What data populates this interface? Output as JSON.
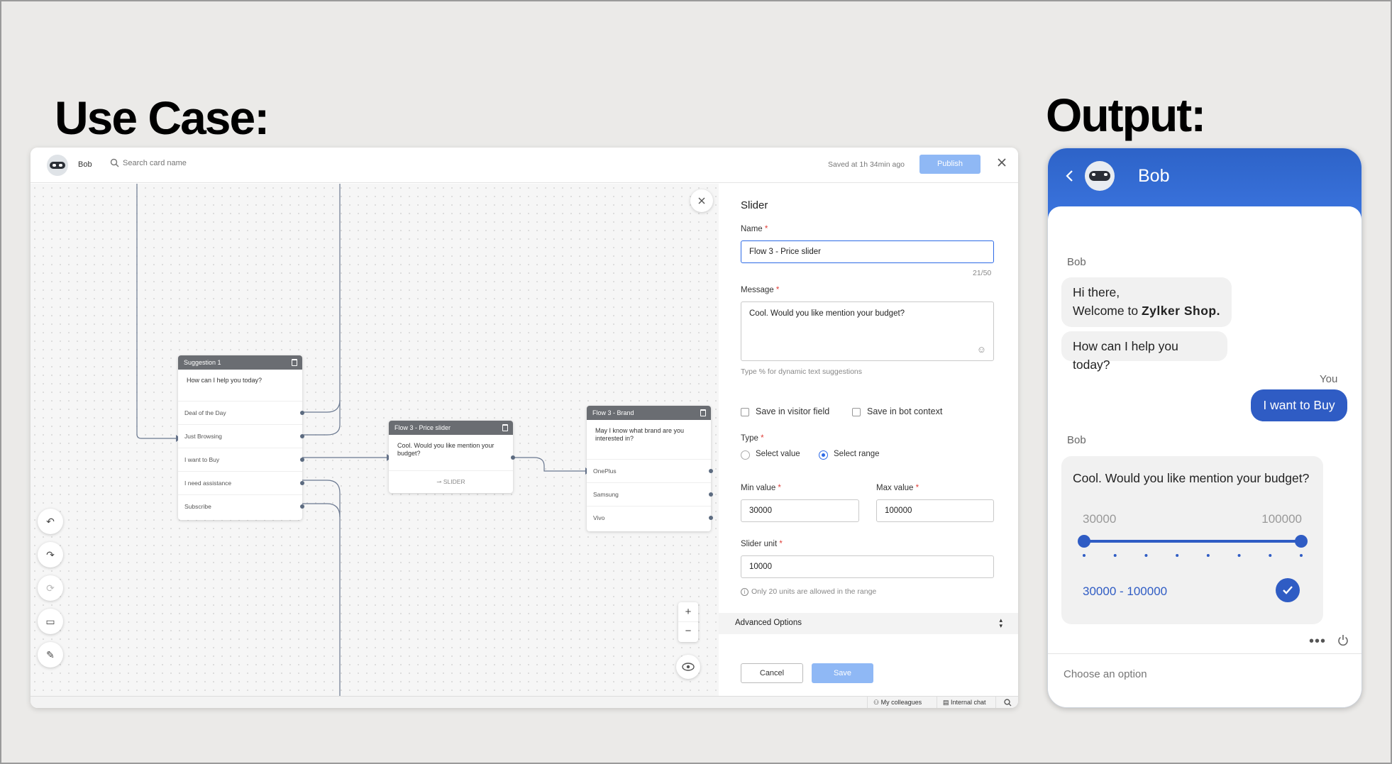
{
  "headings": {
    "use_case": "Use Case:",
    "output": "Output:"
  },
  "builder": {
    "bot_name": "Bob",
    "search_placeholder": "Search card name",
    "saved_status": "Saved at 1h 34min ago",
    "publish_label": "Publish",
    "cards": {
      "suggestion": {
        "title": "Suggestion 1",
        "message": "How can I help you today?",
        "options": [
          "Deal of the Day",
          "Just Browsing",
          "I want to Buy",
          "I need assistance",
          "Subscribe"
        ]
      },
      "price_slider": {
        "title": "Flow 3 - Price slider",
        "message": "Cool. Would you like mention your budget?",
        "footer": "SLIDER"
      },
      "brand": {
        "title": "Flow 3 - Brand",
        "message": "May I know what brand are you interested in?",
        "options": [
          "OnePlus",
          "Samsung",
          "Vivo"
        ]
      }
    },
    "form": {
      "title": "Slider",
      "name_label": "Name",
      "name_value": "Flow 3 - Price slider",
      "name_counter": "21/50",
      "message_label": "Message",
      "message_value": "Cool. Would you like mention your budget?",
      "message_hint": "Type % for dynamic text suggestions",
      "save_visitor_label": "Save in visitor field",
      "save_bot_label": "Save in bot context",
      "type_label": "Type",
      "type_options": [
        "Select value",
        "Select range"
      ],
      "type_selected": "Select range",
      "min_label": "Min value",
      "min_value": "30000",
      "max_label": "Max value",
      "max_value": "100000",
      "unit_label": "Slider unit",
      "unit_value": "10000",
      "unit_hint": "Only 20 units are allowed in the range",
      "advanced_label": "Advanced Options",
      "cancel_label": "Cancel",
      "save_label": "Save"
    },
    "statusbar": {
      "colleagues": "My colleagues",
      "internal_chat": "Internal chat"
    }
  },
  "chat": {
    "bot_name": "Bob",
    "messages": [
      {
        "sender": "Bob",
        "line1": "Hi there,",
        "line2_prefix": "Welcome to ",
        "line2_bold": "Zylker Shop."
      },
      {
        "text": "How can I help you today?"
      },
      {
        "sender": "You",
        "text": "I want to Buy"
      },
      {
        "sender": "Bob",
        "text": "Cool. Would you like mention your budget?"
      }
    ],
    "slider": {
      "min": "30000",
      "max": "100000",
      "selected": "30000 - 100000",
      "steps": 8
    },
    "input_placeholder": "Choose an option"
  }
}
